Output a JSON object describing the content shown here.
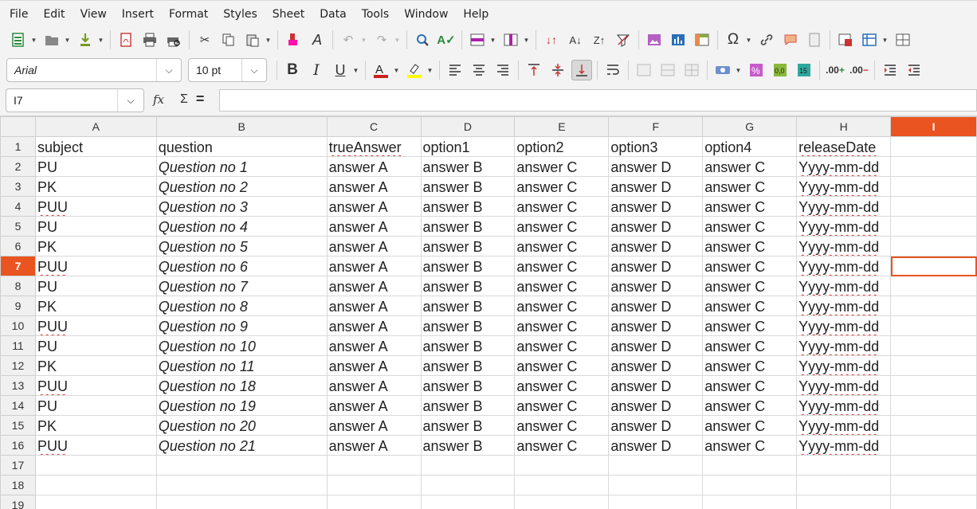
{
  "menu": [
    "File",
    "Edit",
    "View",
    "Insert",
    "Format",
    "Styles",
    "Sheet",
    "Data",
    "Tools",
    "Window",
    "Help"
  ],
  "toolbar": {
    "font_name": "Arial",
    "font_size": "10 pt"
  },
  "formula_bar": {
    "name_box": "I7",
    "fx_label": "fx",
    "sigma": "Σ",
    "equals": "=",
    "content": ""
  },
  "columns": [
    "A",
    "B",
    "C",
    "D",
    "E",
    "F",
    "G",
    "H",
    "I"
  ],
  "active_column": "I",
  "active_row": 7,
  "rows": [
    {
      "n": "1",
      "cells": [
        "subject",
        "question",
        "trueAnswer",
        "option1",
        "option2",
        "option3",
        "option4",
        "releaseDate",
        ""
      ]
    },
    {
      "n": "2",
      "cells": [
        "PU",
        "Question no 1",
        "answer A",
        "answer B",
        "answer C",
        "answer D",
        "answer C",
        "Yyyy-mm-dd",
        ""
      ]
    },
    {
      "n": "3",
      "cells": [
        "PK",
        "Question no 2",
        "answer A",
        "answer B",
        "answer C",
        "answer D",
        "answer C",
        "Yyyy-mm-dd",
        ""
      ]
    },
    {
      "n": "4",
      "cells": [
        "PUU",
        "Question no 3",
        "answer A",
        "answer B",
        "answer C",
        "answer D",
        "answer C",
        "Yyyy-mm-dd",
        ""
      ]
    },
    {
      "n": "5",
      "cells": [
        "PU",
        "Question no 4",
        "answer A",
        "answer B",
        "answer C",
        "answer D",
        "answer C",
        "Yyyy-mm-dd",
        ""
      ]
    },
    {
      "n": "6",
      "cells": [
        "PK",
        "Question no 5",
        "answer A",
        "answer B",
        "answer C",
        "answer D",
        "answer C",
        "Yyyy-mm-dd",
        ""
      ]
    },
    {
      "n": "7",
      "cells": [
        "PUU",
        "Question no 6",
        "answer A",
        "answer B",
        "answer C",
        "answer D",
        "answer C",
        "Yyyy-mm-dd",
        ""
      ]
    },
    {
      "n": "8",
      "cells": [
        "PU",
        "Question no 7",
        "answer A",
        "answer B",
        "answer C",
        "answer D",
        "answer C",
        "Yyyy-mm-dd",
        ""
      ]
    },
    {
      "n": "9",
      "cells": [
        "PK",
        "Question no 8",
        "answer A",
        "answer B",
        "answer C",
        "answer D",
        "answer C",
        "Yyyy-mm-dd",
        ""
      ]
    },
    {
      "n": "10",
      "cells": [
        "PUU",
        "Question no 9",
        "answer A",
        "answer B",
        "answer C",
        "answer D",
        "answer C",
        "Yyyy-mm-dd",
        ""
      ]
    },
    {
      "n": "11",
      "cells": [
        "PU",
        "Question no 10",
        "answer A",
        "answer B",
        "answer C",
        "answer D",
        "answer C",
        "Yyyy-mm-dd",
        ""
      ]
    },
    {
      "n": "12",
      "cells": [
        "PK",
        "Question no 11",
        "answer A",
        "answer B",
        "answer C",
        "answer D",
        "answer C",
        "Yyyy-mm-dd",
        ""
      ]
    },
    {
      "n": "13",
      "cells": [
        "PUU",
        "Question no 18",
        "answer A",
        "answer B",
        "answer C",
        "answer D",
        "answer C",
        "Yyyy-mm-dd",
        ""
      ]
    },
    {
      "n": "14",
      "cells": [
        "PU",
        "Question no 19",
        "answer A",
        "answer B",
        "answer C",
        "answer D",
        "answer C",
        "Yyyy-mm-dd",
        ""
      ]
    },
    {
      "n": "15",
      "cells": [
        "PK",
        "Question no 20",
        "answer A",
        "answer B",
        "answer C",
        "answer D",
        "answer C",
        "Yyyy-mm-dd",
        ""
      ]
    },
    {
      "n": "16",
      "cells": [
        "PUU",
        "Question no 21",
        "answer A",
        "answer B",
        "answer C",
        "answer D",
        "answer C",
        "Yyyy-mm-dd",
        ""
      ]
    },
    {
      "n": "17",
      "cells": [
        "",
        "",
        "",
        "",
        "",
        "",
        "",
        "",
        ""
      ]
    },
    {
      "n": "18",
      "cells": [
        "",
        "",
        "",
        "",
        "",
        "",
        "",
        "",
        ""
      ]
    },
    {
      "n": "19",
      "cells": [
        "",
        "",
        "",
        "",
        "",
        "",
        "",
        "",
        ""
      ]
    }
  ],
  "spellcheck_words": [
    "trueAnswer",
    "releaseDate",
    "PUU",
    "Yyyy-mm-dd"
  ],
  "accent_color": "#e95420"
}
